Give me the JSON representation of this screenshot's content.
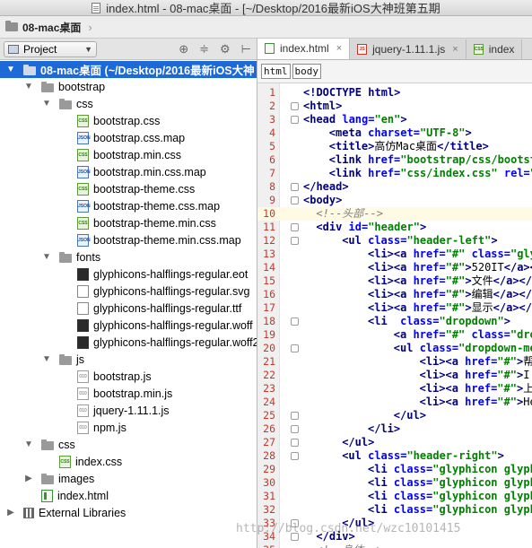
{
  "window": {
    "title": "index.html - 08-mac桌面 - [~/Desktop/2016最新iOS大神班第五期"
  },
  "breadcrumb": {
    "root": "08-mac桌面"
  },
  "project_panel": {
    "view_selector": "Project",
    "tool_icons": [
      "target-icon",
      "collapse-icon",
      "gear-icon",
      "hide-icon"
    ]
  },
  "tree": [
    {
      "label": "08-mac桌面 (~/Desktop/2016最新iOS大神",
      "type": "folder",
      "depth": 0,
      "expanded": true,
      "selected": true
    },
    {
      "label": "bootstrap",
      "type": "folder",
      "depth": 1,
      "expanded": true
    },
    {
      "label": "css",
      "type": "folder",
      "depth": 2,
      "expanded": true
    },
    {
      "label": "bootstrap.css",
      "type": "css",
      "depth": 3
    },
    {
      "label": "bootstrap.css.map",
      "type": "json",
      "depth": 3
    },
    {
      "label": "bootstrap.min.css",
      "type": "css",
      "depth": 3
    },
    {
      "label": "bootstrap.min.css.map",
      "type": "json",
      "depth": 3
    },
    {
      "label": "bootstrap-theme.css",
      "type": "css",
      "depth": 3
    },
    {
      "label": "bootstrap-theme.css.map",
      "type": "json",
      "depth": 3
    },
    {
      "label": "bootstrap-theme.min.css",
      "type": "css",
      "depth": 3
    },
    {
      "label": "bootstrap-theme.min.css.map",
      "type": "json",
      "depth": 3
    },
    {
      "label": "fonts",
      "type": "folder",
      "depth": 2,
      "expanded": true
    },
    {
      "label": "glyphicons-halflings-regular.eot",
      "type": "dark",
      "depth": 3
    },
    {
      "label": "glyphicons-halflings-regular.svg",
      "type": "file",
      "depth": 3
    },
    {
      "label": "glyphicons-halflings-regular.ttf",
      "type": "file",
      "depth": 3
    },
    {
      "label": "glyphicons-halflings-regular.woff",
      "type": "dark",
      "depth": 3
    },
    {
      "label": "glyphicons-halflings-regular.woff2",
      "type": "dark",
      "depth": 3
    },
    {
      "label": "js",
      "type": "folder",
      "depth": 2,
      "expanded": true
    },
    {
      "label": "bootstrap.js",
      "type": "js",
      "depth": 3
    },
    {
      "label": "bootstrap.min.js",
      "type": "js",
      "depth": 3
    },
    {
      "label": "jquery-1.11.1.js",
      "type": "js",
      "depth": 3
    },
    {
      "label": "npm.js",
      "type": "js",
      "depth": 3
    },
    {
      "label": "css",
      "type": "folder",
      "depth": 1,
      "expanded": true
    },
    {
      "label": "index.css",
      "type": "css",
      "depth": 2
    },
    {
      "label": "images",
      "type": "folder",
      "depth": 1,
      "expanded": false
    },
    {
      "label": "index.html",
      "type": "html",
      "depth": 1
    },
    {
      "label": "External Libraries",
      "type": "lib",
      "depth": 0,
      "expanded": false
    }
  ],
  "tabs": [
    {
      "label": "index.html",
      "type": "html",
      "active": true
    },
    {
      "label": "jquery-1.11.1.js",
      "type": "js",
      "active": false
    },
    {
      "label": "index",
      "type": "css",
      "active": false
    }
  ],
  "element_path": [
    "html",
    "body"
  ],
  "editor": {
    "current_line": 10,
    "lines": [
      {
        "n": "1",
        "fold": false,
        "indent": 0,
        "tokens": [
          [
            "tg",
            "<!DOCTYPE html>"
          ]
        ]
      },
      {
        "n": "2",
        "fold": true,
        "indent": 0,
        "tokens": [
          [
            "tg",
            "<html>"
          ]
        ]
      },
      {
        "n": "3",
        "fold": true,
        "indent": 0,
        "tokens": [
          [
            "tg",
            "<head "
          ],
          [
            "at",
            "lang="
          ],
          [
            "st",
            "\"en\""
          ],
          [
            "tg",
            ">"
          ]
        ]
      },
      {
        "n": "4",
        "fold": false,
        "indent": 4,
        "tokens": [
          [
            "tg",
            "<meta "
          ],
          [
            "at",
            "charset="
          ],
          [
            "st",
            "\"UTF-8\""
          ],
          [
            "tg",
            ">"
          ]
        ]
      },
      {
        "n": "5",
        "fold": false,
        "indent": 4,
        "tokens": [
          [
            "tg",
            "<title>"
          ],
          [
            "tx",
            "高仿Mac桌面"
          ],
          [
            "tg",
            "</title>"
          ]
        ]
      },
      {
        "n": "6",
        "fold": false,
        "indent": 4,
        "tokens": [
          [
            "tg",
            "<link "
          ],
          [
            "at",
            "href="
          ],
          [
            "st",
            "\"bootstrap/css/bootstr"
          ]
        ]
      },
      {
        "n": "7",
        "fold": false,
        "indent": 4,
        "tokens": [
          [
            "tg",
            "<link "
          ],
          [
            "at",
            "href="
          ],
          [
            "st",
            "\"css/index.css\""
          ],
          [
            "at",
            " rel="
          ],
          [
            "st",
            "\"s"
          ]
        ]
      },
      {
        "n": "8",
        "fold": true,
        "indent": 0,
        "tokens": [
          [
            "tg",
            "</head>"
          ]
        ]
      },
      {
        "n": "9",
        "fold": true,
        "indent": 0,
        "tokens": [
          [
            "tg",
            "<body>"
          ]
        ]
      },
      {
        "n": "10",
        "fold": false,
        "indent": 2,
        "tokens": [
          [
            "cm",
            "<!--头部-->"
          ]
        ]
      },
      {
        "n": "11",
        "fold": true,
        "indent": 2,
        "tokens": [
          [
            "tg",
            "<div "
          ],
          [
            "at",
            "id="
          ],
          [
            "st",
            "\"header\""
          ],
          [
            "tg",
            ">"
          ]
        ]
      },
      {
        "n": "12",
        "fold": true,
        "indent": 6,
        "tokens": [
          [
            "tg",
            "<ul "
          ],
          [
            "at",
            "class="
          ],
          [
            "st",
            "\"header-left\""
          ],
          [
            "tg",
            ">"
          ]
        ]
      },
      {
        "n": "13",
        "fold": false,
        "indent": 10,
        "tokens": [
          [
            "tg",
            "<li><a "
          ],
          [
            "at",
            "href="
          ],
          [
            "st",
            "\"#\""
          ],
          [
            "at",
            " class="
          ],
          [
            "st",
            "\"glyp"
          ]
        ]
      },
      {
        "n": "14",
        "fold": false,
        "indent": 10,
        "tokens": [
          [
            "tg",
            "<li><a "
          ],
          [
            "at",
            "href="
          ],
          [
            "st",
            "\"#\""
          ],
          [
            "tg",
            ">"
          ],
          [
            "tx",
            "520IT"
          ],
          [
            "tg",
            "</a></"
          ]
        ]
      },
      {
        "n": "15",
        "fold": false,
        "indent": 10,
        "tokens": [
          [
            "tg",
            "<li><a "
          ],
          [
            "at",
            "href="
          ],
          [
            "st",
            "\"#\""
          ],
          [
            "tg",
            ">"
          ],
          [
            "tx",
            "文件"
          ],
          [
            "tg",
            "</a></"
          ]
        ]
      },
      {
        "n": "16",
        "fold": false,
        "indent": 10,
        "tokens": [
          [
            "tg",
            "<li><a "
          ],
          [
            "at",
            "href="
          ],
          [
            "st",
            "\"#\""
          ],
          [
            "tg",
            ">"
          ],
          [
            "tx",
            "编辑"
          ],
          [
            "tg",
            "</a></l"
          ]
        ]
      },
      {
        "n": "17",
        "fold": false,
        "indent": 10,
        "tokens": [
          [
            "tg",
            "<li><a "
          ],
          [
            "at",
            "href="
          ],
          [
            "st",
            "\"#\""
          ],
          [
            "tg",
            ">"
          ],
          [
            "tx",
            "显示"
          ],
          [
            "tg",
            "</a></l"
          ]
        ]
      },
      {
        "n": "18",
        "fold": true,
        "indent": 10,
        "tokens": [
          [
            "tg",
            "<li  "
          ],
          [
            "at",
            "class="
          ],
          [
            "st",
            "\"dropdown\""
          ],
          [
            "tg",
            ">"
          ]
        ]
      },
      {
        "n": "19",
        "fold": false,
        "indent": 14,
        "tokens": [
          [
            "tg",
            "<a "
          ],
          [
            "at",
            "href="
          ],
          [
            "st",
            "\"#\""
          ],
          [
            "at",
            " class="
          ],
          [
            "st",
            "\"drop"
          ]
        ]
      },
      {
        "n": "20",
        "fold": true,
        "indent": 14,
        "tokens": [
          [
            "tg",
            "<ul "
          ],
          [
            "at",
            "class="
          ],
          [
            "st",
            "\"dropdown-men"
          ]
        ]
      },
      {
        "n": "21",
        "fold": false,
        "indent": 18,
        "tokens": [
          [
            "tg",
            "<li><a "
          ],
          [
            "at",
            "href="
          ],
          [
            "st",
            "\"#\""
          ],
          [
            "tg",
            ">"
          ],
          [
            "tx",
            "帮助"
          ]
        ]
      },
      {
        "n": "22",
        "fold": false,
        "indent": 18,
        "tokens": [
          [
            "tg",
            "<li><a "
          ],
          [
            "at",
            "href="
          ],
          [
            "st",
            "\"#\""
          ],
          [
            "tg",
            ">"
          ],
          [
            "tx",
            "I m"
          ]
        ]
      },
      {
        "n": "23",
        "fold": false,
        "indent": 18,
        "tokens": [
          [
            "tg",
            "<li><a "
          ],
          [
            "at",
            "href="
          ],
          [
            "st",
            "\"#\""
          ],
          [
            "tg",
            ">"
          ],
          [
            "tx",
            "上网"
          ]
        ]
      },
      {
        "n": "24",
        "fold": false,
        "indent": 18,
        "tokens": [
          [
            "tg",
            "<li><a "
          ],
          [
            "at",
            "href="
          ],
          [
            "st",
            "\"#\""
          ],
          [
            "tg",
            ">"
          ],
          [
            "tx",
            "Hel"
          ]
        ]
      },
      {
        "n": "25",
        "fold": true,
        "indent": 14,
        "tokens": [
          [
            "tg",
            "</ul>"
          ]
        ]
      },
      {
        "n": "26",
        "fold": true,
        "indent": 10,
        "tokens": [
          [
            "tg",
            "</li>"
          ]
        ]
      },
      {
        "n": "27",
        "fold": true,
        "indent": 6,
        "tokens": [
          [
            "tg",
            "</ul>"
          ]
        ]
      },
      {
        "n": "28",
        "fold": true,
        "indent": 6,
        "tokens": [
          [
            "tg",
            "<ul "
          ],
          [
            "at",
            "class="
          ],
          [
            "st",
            "\"header-right\""
          ],
          [
            "tg",
            ">"
          ]
        ]
      },
      {
        "n": "29",
        "fold": false,
        "indent": 10,
        "tokens": [
          [
            "tg",
            "<li "
          ],
          [
            "at",
            "class="
          ],
          [
            "st",
            "\"glyphicon glyphi"
          ]
        ]
      },
      {
        "n": "30",
        "fold": false,
        "indent": 10,
        "tokens": [
          [
            "tg",
            "<li "
          ],
          [
            "at",
            "class="
          ],
          [
            "st",
            "\"glyphicon glyphi"
          ]
        ]
      },
      {
        "n": "31",
        "fold": false,
        "indent": 10,
        "tokens": [
          [
            "tg",
            "<li "
          ],
          [
            "at",
            "class="
          ],
          [
            "st",
            "\"glyphicon glyphi"
          ]
        ]
      },
      {
        "n": "32",
        "fold": false,
        "indent": 10,
        "tokens": [
          [
            "tg",
            "<li "
          ],
          [
            "at",
            "class="
          ],
          [
            "st",
            "\"glyphicon glyphi"
          ]
        ]
      },
      {
        "n": "33",
        "fold": true,
        "indent": 6,
        "tokens": [
          [
            "tg",
            "</ul>"
          ]
        ]
      },
      {
        "n": "34",
        "fold": true,
        "indent": 2,
        "tokens": [
          [
            "tg",
            "</div>"
          ]
        ]
      },
      {
        "n": "35",
        "fold": false,
        "indent": 2,
        "tokens": [
          [
            "cm",
            "<!--身体-->"
          ]
        ]
      }
    ]
  },
  "watermark": "http://blog.csdn.net/wzc10101415"
}
